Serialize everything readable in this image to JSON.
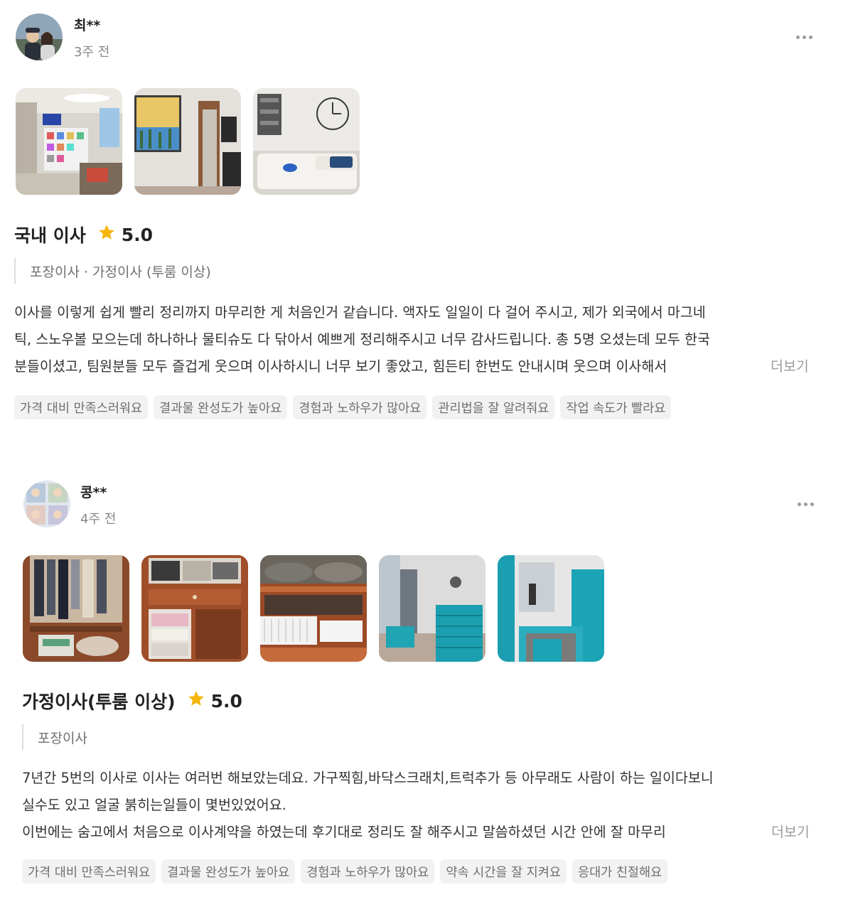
{
  "reviews": [
    {
      "author": "최**",
      "time_ago": "3주 전",
      "more_icon": "more-horizontal-icon",
      "photos": [
        "living-room-photo",
        "painting-hallway-photo",
        "white-sofa-photo"
      ],
      "service_title": "국내 이사",
      "rating": "5.0",
      "sub_services": "포장이사 · 가정이사 (투룸 이상)",
      "text_lines": [
        "이사를 이렇게 쉽게 빨리 정리까지 마무리한 게 처음인거 같습니다. 액자도 일일이 다 걸어 주시고, 제가 외국에서 마그네",
        "틱, 스노우볼 모으는데 하나하나 물티슈도 다 닦아서 예쁘게 정리해주시고 너무 감사드립니다. 총 5명 오셨는데 모두 한국",
        "분들이셨고, 팀원분들 모두 즐겁게 웃으며 이사하시니 너무 보기 좋았고, 힘든티 한번도 안내시며 웃으며 이사해서"
      ],
      "more_label": "더보기",
      "tags": [
        "가격 대비 만족스러워요",
        "결과물 완성도가 높아요",
        "경험과 노하우가 많아요",
        "관리법을 잘 알려줘요",
        "작업 속도가 빨라요"
      ]
    },
    {
      "author": "콩**",
      "time_ago": "4주 전",
      "more_icon": "more-horizontal-icon",
      "photos": [
        "wardrobe-clothes-photo",
        "drawer-cabinet-photo",
        "shelf-baskets-photo",
        "moving-boxes-room-photo",
        "hallway-boxes-photo"
      ],
      "service_title": "가정이사(투룸 이상)",
      "rating": "5.0",
      "sub_services": "포장이사",
      "text_lines": [
        "7년간 5번의 이사로 이사는 여러번 해보았는데요. 가구찍힘,바닥스크래치,트럭추가 등 아무래도 사람이 하는 일이다보니",
        "실수도 있고 얼굴 붉히는일들이 몇번있었어요.",
        "이번에는 숨고에서 처음으로 이사계약을 하였는데 후기대로 정리도 잘 해주시고 말씀하셨던 시간 안에 잘 마무리"
      ],
      "more_label": "더보기",
      "tags": [
        "가격 대비 만족스러워요",
        "결과물 완성도가 높아요",
        "경험과 노하우가 많아요",
        "약속 시간을 잘 지켜요",
        "응대가 친절해요"
      ]
    }
  ],
  "colors": {
    "star": "#f5b50a",
    "tag_bg": "#f2f2f2",
    "muted_text": "#888888"
  }
}
